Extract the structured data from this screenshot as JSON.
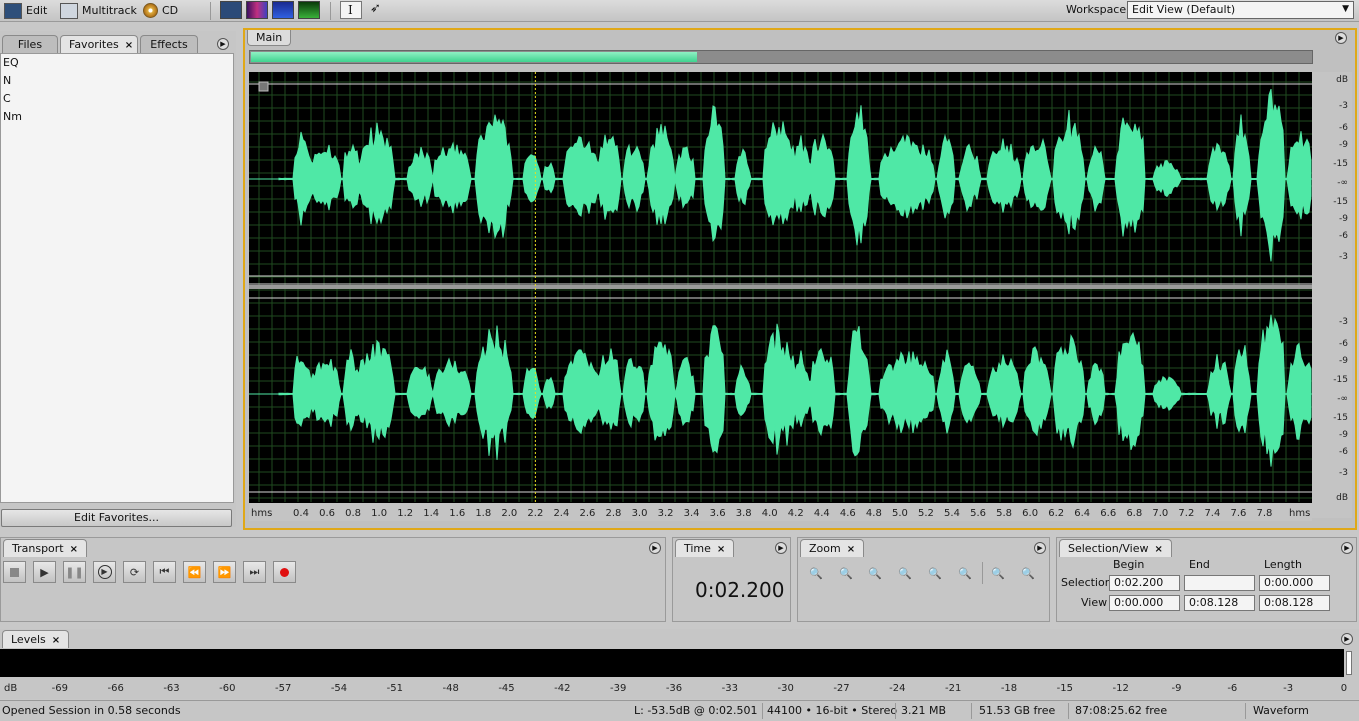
{
  "toolbar": {
    "edit_label": "Edit",
    "multitrack_label": "Multitrack",
    "cd_label": "CD",
    "workspace_label": "Workspace:",
    "workspace_value": "Edit View (Default)"
  },
  "left_panel": {
    "tabs": [
      {
        "label": "Files"
      },
      {
        "label": "Favorites"
      },
      {
        "label": "Effects"
      }
    ],
    "favorites": [
      "EQ",
      "N",
      "C",
      "Nm"
    ],
    "edit_favorites_label": "Edit Favorites..."
  },
  "main": {
    "tab_label": "Main",
    "overview_visible_fraction": 0.42,
    "playhead_time": 2.2,
    "time_ruler": {
      "unit_label": "hms",
      "ticks": [
        "0.4",
        "0.6",
        "0.8",
        "1.0",
        "1.2",
        "1.4",
        "1.6",
        "1.8",
        "2.0",
        "2.2",
        "2.4",
        "2.6",
        "2.8",
        "3.0",
        "3.2",
        "3.4",
        "3.6",
        "3.8",
        "4.0",
        "4.2",
        "4.4",
        "4.6",
        "4.8",
        "5.0",
        "5.2",
        "5.4",
        "5.6",
        "5.8",
        "6.0",
        "6.2",
        "6.4",
        "6.6",
        "6.8",
        "7.0",
        "7.2",
        "7.4",
        "7.6",
        "7.8"
      ]
    },
    "db_scale": {
      "unit_label": "dB",
      "top_channel": [
        "-3",
        "-6",
        "-9",
        "-15",
        "-∞",
        "-15",
        "-9",
        "-6",
        "-3"
      ],
      "bottom_channel": [
        "-3",
        "-6",
        "-9",
        "-15",
        "-∞",
        "-15",
        "-9",
        "-6",
        "-3"
      ]
    },
    "waveform_color": "#4fe8a6",
    "grid_color": "#1f4a1f"
  },
  "transport": {
    "tab_label": "Transport",
    "buttons": [
      "stop",
      "play",
      "pause",
      "play-from-cursor",
      "loop",
      "go-to-start",
      "rewind",
      "fast-forward",
      "go-to-end",
      "record"
    ]
  },
  "time": {
    "tab_label": "Time",
    "value": "0:02.200"
  },
  "zoom": {
    "tab_label": "Zoom"
  },
  "selection_view": {
    "tab_label": "Selection/View",
    "headers": {
      "begin": "Begin",
      "end": "End",
      "length": "Length"
    },
    "selection_label": "Selection",
    "view_label": "View",
    "selection": {
      "begin": "0:02.200",
      "end": "",
      "length": "0:00.000"
    },
    "view": {
      "begin": "0:00.000",
      "end": "0:08.128",
      "length": "0:08.128"
    }
  },
  "levels": {
    "tab_label": "Levels",
    "ticks": [
      "dB",
      "-69",
      "-66",
      "-63",
      "-60",
      "-57",
      "-54",
      "-51",
      "-48",
      "-45",
      "-42",
      "-39",
      "-36",
      "-33",
      "-30",
      "-27",
      "-24",
      "-21",
      "-18",
      "-15",
      "-12",
      "-9",
      "-6",
      "-3",
      "0"
    ]
  },
  "status": {
    "message": "Opened Session in 0.58 seconds",
    "cursor_info": "L: -53.5dB @   0:02.501",
    "format": "44100 • 16-bit • Stereo",
    "file_size": "3.21 MB",
    "disk_free": "51.53 GB free",
    "time_free": "87:08:25.62 free",
    "view_mode": "Waveform"
  }
}
